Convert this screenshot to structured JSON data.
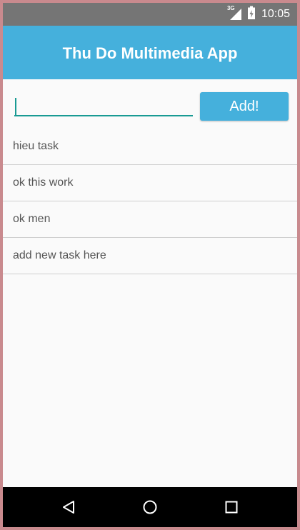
{
  "status_bar": {
    "network_label": "3G",
    "time": "10:05",
    "icons": [
      "signal-icon",
      "battery-icon"
    ]
  },
  "app_bar": {
    "title": "Thu Do Multimedia App"
  },
  "input": {
    "value": "",
    "placeholder": ""
  },
  "add_button": {
    "label": "Add!"
  },
  "tasks": [
    {
      "text": "hieu task"
    },
    {
      "text": "ok this work"
    },
    {
      "text": "ok men"
    },
    {
      "text": "add new task here"
    }
  ],
  "nav_bar": {
    "icons": [
      "back-icon",
      "home-icon",
      "recents-icon"
    ]
  },
  "colors": {
    "accent": "#45b0dc",
    "input_underline": "#199a93",
    "status_bar": "#757575",
    "nav_bar": "#000000",
    "frame": "#c98a8e"
  }
}
